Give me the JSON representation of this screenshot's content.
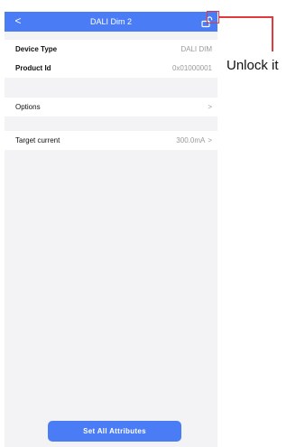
{
  "header": {
    "back_glyph": "<",
    "title": "DALI Dim 2",
    "lock_icon": "unlock-icon",
    "color": "#4a7cf6"
  },
  "info_section": {
    "rows": [
      {
        "label": "Device Type",
        "value": "DALI DIM"
      },
      {
        "label": "Product Id",
        "value": "0x01000001"
      }
    ]
  },
  "options_section": {
    "label": "Options",
    "chevron": ">"
  },
  "target_section": {
    "label": "Target current",
    "value": "300.0mA",
    "chevron": ">"
  },
  "footer": {
    "button_label": "Set All Attributes"
  },
  "annotation": {
    "text": "Unlock it",
    "color": "#e0393e"
  }
}
